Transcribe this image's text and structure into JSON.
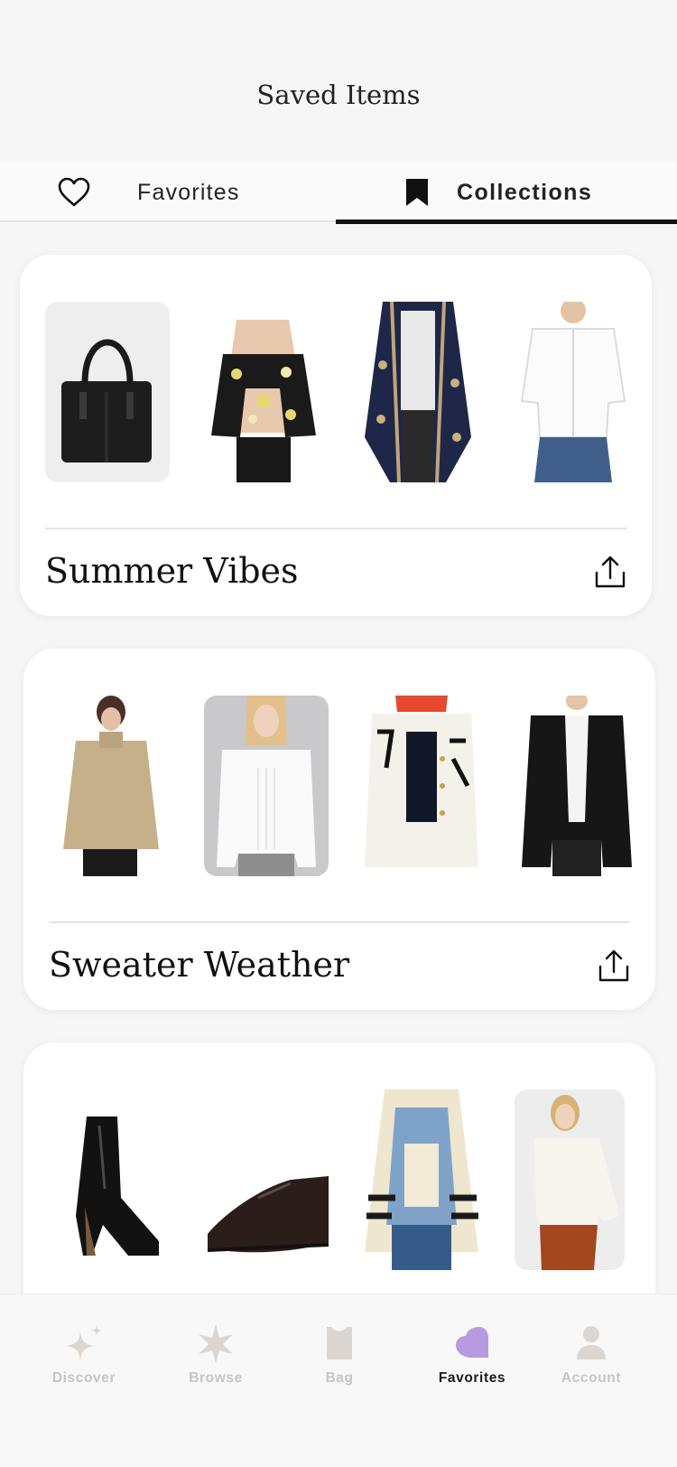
{
  "header": {
    "title": "Saved Items"
  },
  "tabs": [
    {
      "label": "Favorites",
      "icon": "heart-outline-icon",
      "active": false
    },
    {
      "label": "Collections",
      "icon": "bookmark-icon",
      "active": true
    }
  ],
  "collections": [
    {
      "name": "Summer Vibes",
      "items": [
        "black leather tote bag",
        "floral cold-shoulder top",
        "navy embroidered kimono",
        "white button-up shirt"
      ]
    },
    {
      "name": "Sweater Weather",
      "items": [
        "camel turtleneck sweater",
        "white pleated blouse",
        "white graphic denim jacket",
        "black blazer"
      ]
    },
    {
      "name": "",
      "items": [
        "black patent ankle boot",
        "brown leather oxford shoe",
        "denim jacket with striped layer",
        "white turtleneck with rust pants"
      ]
    }
  ],
  "bottom_nav": [
    {
      "label": "Discover",
      "icon": "sparkle-icon",
      "active": false
    },
    {
      "label": "Browse",
      "icon": "star-icon",
      "active": false
    },
    {
      "label": "Bag",
      "icon": "bag-icon",
      "active": false
    },
    {
      "label": "Favorites",
      "icon": "heart-icon",
      "active": true
    },
    {
      "label": "Account",
      "icon": "person-icon",
      "active": false
    }
  ],
  "colors": {
    "accent": "#b79ae0",
    "inactive_nav": "#dcd6d2",
    "active_tab_underline": "#111111"
  }
}
